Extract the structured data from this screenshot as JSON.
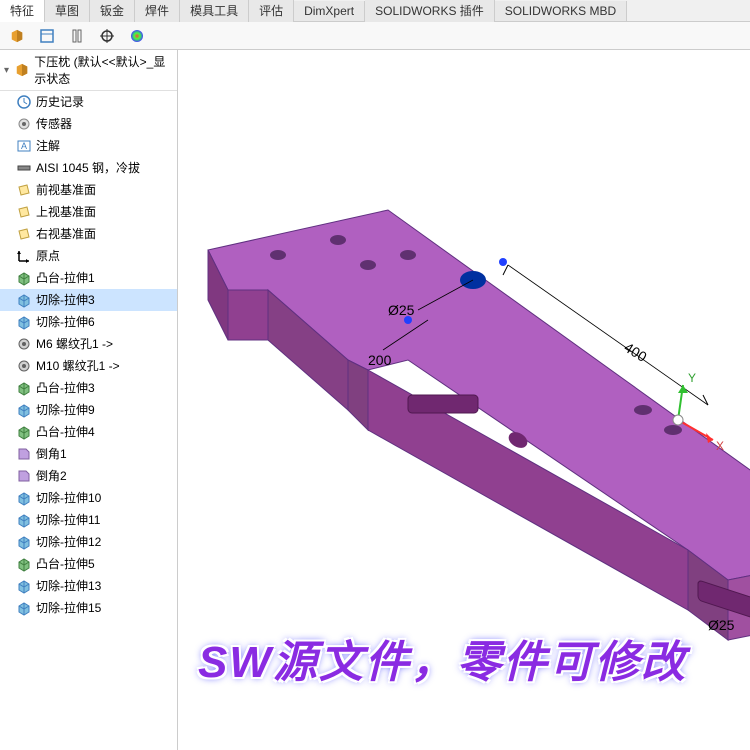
{
  "ribbon": {
    "tabs": [
      "特征",
      "草图",
      "钣金",
      "焊件",
      "模具工具",
      "评估",
      "DimXpert",
      "SOLIDWORKS 插件",
      "SOLIDWORKS MBD"
    ]
  },
  "tree": {
    "root_name": "下压枕 (默认<<默认>_显示状态",
    "items": [
      {
        "icon": "history",
        "label": "历史记录"
      },
      {
        "icon": "sensor",
        "label": "传感器"
      },
      {
        "icon": "annotation",
        "label": "注解"
      },
      {
        "icon": "material",
        "label": "AISI 1045 钢，冷拔"
      },
      {
        "icon": "plane",
        "label": "前视基准面"
      },
      {
        "icon": "plane",
        "label": "上视基准面"
      },
      {
        "icon": "plane",
        "label": "右视基准面"
      },
      {
        "icon": "origin",
        "label": "原点"
      },
      {
        "icon": "extrude",
        "label": "凸台-拉伸1"
      },
      {
        "icon": "cut",
        "label": "切除-拉伸3",
        "selected": true
      },
      {
        "icon": "cut",
        "label": "切除-拉伸6"
      },
      {
        "icon": "hole",
        "label": "M6 螺纹孔1 ->"
      },
      {
        "icon": "hole",
        "label": "M10 螺纹孔1 ->"
      },
      {
        "icon": "extrude",
        "label": "凸台-拉伸3"
      },
      {
        "icon": "cut",
        "label": "切除-拉伸9"
      },
      {
        "icon": "extrude",
        "label": "凸台-拉伸4"
      },
      {
        "icon": "chamfer",
        "label": "倒角1"
      },
      {
        "icon": "chamfer",
        "label": "倒角2"
      },
      {
        "icon": "cut",
        "label": "切除-拉伸10"
      },
      {
        "icon": "cut",
        "label": "切除-拉伸11"
      },
      {
        "icon": "cut",
        "label": "切除-拉伸12"
      },
      {
        "icon": "extrude",
        "label": "凸台-拉伸5"
      },
      {
        "icon": "cut",
        "label": "切除-拉伸13"
      },
      {
        "icon": "cut",
        "label": "切除-拉伸15"
      }
    ]
  },
  "dimensions": {
    "d1": "Ø25",
    "d2": "200",
    "d3": "400",
    "d4": "Ø25"
  },
  "axes": {
    "x": "X",
    "y": "Y"
  },
  "watermark": "SW源文件，零件可修改"
}
